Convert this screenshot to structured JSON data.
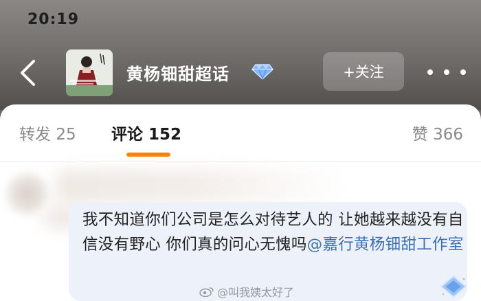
{
  "status_bar": {
    "time": "20:19"
  },
  "header": {
    "title": "黄杨钿甜超话",
    "follow_label": "+关注"
  },
  "tabs": [
    {
      "label": "转发",
      "count": "25"
    },
    {
      "label": "评论",
      "count": "152",
      "active": true
    },
    {
      "label": "赞",
      "count": "366"
    }
  ],
  "comment": {
    "text": "我不知道你们公司是怎么对待艺人的 让她越来越没有自信没有野心 你们真的问心无愧吗",
    "mention": "@嘉行黄杨钿甜工作室"
  },
  "watermark": "@叫我姨太好了",
  "icons": {
    "back": "back-chevron-icon",
    "badge": "diamond-badge-icon",
    "more": "more-dots-icon"
  },
  "colors": {
    "accent": "#ff8200",
    "mention": "#3d6fb3",
    "bubble": "#ecf1fa"
  }
}
